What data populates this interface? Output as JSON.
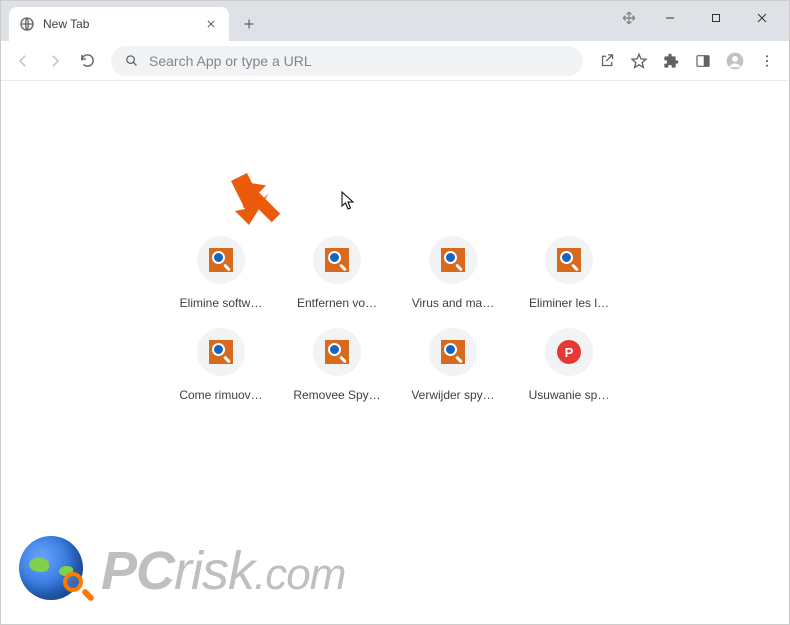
{
  "tab": {
    "title": "New Tab"
  },
  "omnibox": {
    "placeholder": "Search App or type a URL"
  },
  "shortcuts": [
    {
      "label": "Elimine softw…",
      "favicon": "a"
    },
    {
      "label": "Entfernen vo…",
      "favicon": "a"
    },
    {
      "label": "Virus and ma…",
      "favicon": "a"
    },
    {
      "label": "Eliminer les l…",
      "favicon": "a"
    },
    {
      "label": "Come rimuov…",
      "favicon": "a"
    },
    {
      "label": "Removee Spy…",
      "favicon": "a"
    },
    {
      "label": "Verwijder spy…",
      "favicon": "a"
    },
    {
      "label": "Usuwanie sp…",
      "favicon": "p",
      "letter": "P"
    }
  ],
  "watermark": {
    "text_pc": "PC",
    "text_rest": "risk",
    "text_domain": ".com"
  }
}
